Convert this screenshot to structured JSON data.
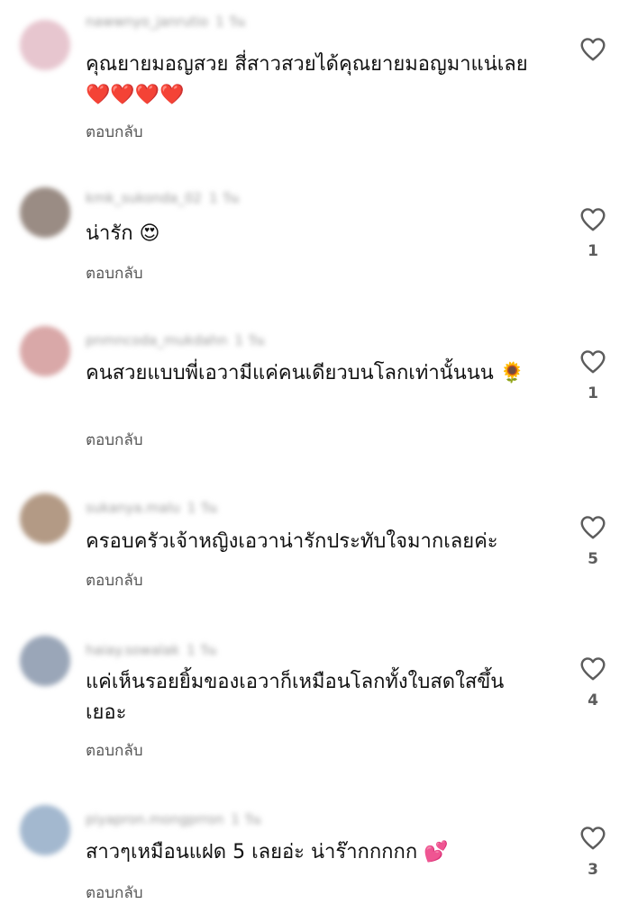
{
  "reply_label": "ตอบกลับ",
  "icons": {
    "like": "heart-outline-icon"
  },
  "colors": {
    "text": "#111111",
    "muted": "#9a9a9a",
    "reply": "#555555",
    "heart": "#5c5c5c"
  },
  "comments": [
    {
      "username": "nawwnyo_janrutio",
      "time": "1 วัน",
      "text": "คุณยายมอญสวย สี่สาวสวยได้คุณยายมอญมาแน่เลย",
      "emoji": [
        "❤️",
        "❤️",
        "❤️",
        "❤️"
      ],
      "likes": ""
    },
    {
      "username": "kmk_sukonda_02",
      "time": "1 วัน",
      "text": "น่ารัก",
      "emoji": [
        "😍"
      ],
      "likes": "1"
    },
    {
      "username": "pnmncoda_mukdahn",
      "time": "1 วัน",
      "text": "คนสวยแบบพี่เอวามีแค่คนเดียวบนโลกเท่านั้นนน",
      "emoji": [
        "🌻"
      ],
      "likes": "1"
    },
    {
      "username": "sukanya.malu",
      "time": "1 วัน",
      "text": "ครอบครัวเจ้าหญิงเอวาน่ารักประทับใจมากเลยค่ะ",
      "emoji": [],
      "likes": "5"
    },
    {
      "username": "haiay.sowalak",
      "time": "1 วัน",
      "text": "แค่เห็นรอยยิ้มของเอวาก็เหมือนโลกทั้งใบสดใสขึ้นเยอะ",
      "emoji": [],
      "likes": "4"
    },
    {
      "username": "piyapron.mongprron",
      "time": "1 วัน",
      "text": "สาวๆเหมือนแฝด 5 เลยอ่ะ น่าร๊ากกกกก",
      "emoji": [
        "💕"
      ],
      "likes": "3"
    }
  ]
}
